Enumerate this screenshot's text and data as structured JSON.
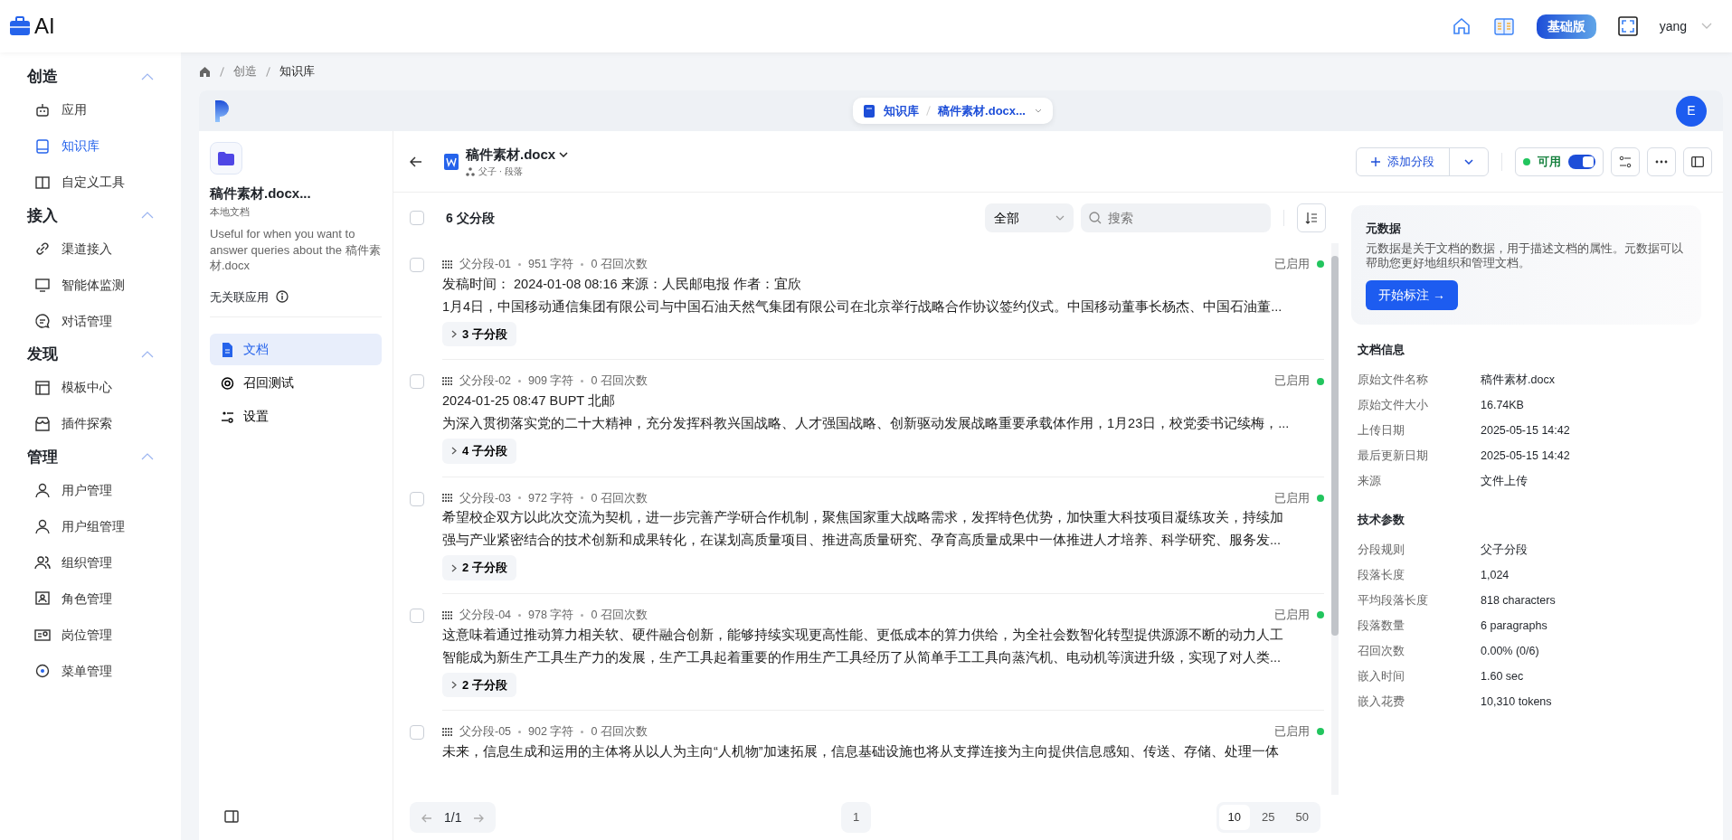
{
  "app": {
    "logo": "AI"
  },
  "header": {
    "edition": "基础版",
    "user": "yang"
  },
  "sidebar": {
    "groups": [
      {
        "title": "创造",
        "expanded": true,
        "items": [
          {
            "label": "应用",
            "selected": false
          },
          {
            "label": "知识库",
            "selected": true
          },
          {
            "label": "自定义工具",
            "selected": false
          }
        ]
      },
      {
        "title": "接入",
        "expanded": true,
        "items": [
          {
            "label": "渠道接入",
            "selected": false
          },
          {
            "label": "智能体监测",
            "selected": false
          },
          {
            "label": "对话管理",
            "selected": false
          }
        ]
      },
      {
        "title": "发现",
        "expanded": true,
        "items": [
          {
            "label": "模板中心",
            "selected": false
          },
          {
            "label": "插件探索",
            "selected": false
          }
        ]
      },
      {
        "title": "管理",
        "expanded": true,
        "items": [
          {
            "label": "用户管理",
            "selected": false
          },
          {
            "label": "用户组管理",
            "selected": false
          },
          {
            "label": "组织管理",
            "selected": false
          },
          {
            "label": "角色管理",
            "selected": false
          },
          {
            "label": "岗位管理",
            "selected": false
          },
          {
            "label": "菜单管理",
            "selected": false
          }
        ]
      }
    ]
  },
  "breadcrumb": [
    "创造",
    "知识库"
  ],
  "topbar": {
    "pill_base": "知识库",
    "pill_doc": "稿件素材.docx...",
    "avatar": "E"
  },
  "doc_panel": {
    "name": "稿件素材.docx...",
    "source": "本地文档",
    "description": "Useful for when you want to answer queries about the 稿件素材.docx",
    "linked_apps": "无关联应用",
    "nav": [
      {
        "label": "文档",
        "selected": true
      },
      {
        "label": "召回测试",
        "selected": false
      },
      {
        "label": "设置",
        "selected": false
      }
    ]
  },
  "document": {
    "title": "稿件素材.docx",
    "subtitle": "父子 · 段落",
    "add_button": "添加分段",
    "status": {
      "label": "可用",
      "on": true
    }
  },
  "segments_header": {
    "count": "6 父分段",
    "checked": false,
    "filter": "全部",
    "search_placeholder": "搜索"
  },
  "segments": [
    {
      "id": "父分段-01",
      "chars": "951 字符",
      "recalls": "0 召回次数",
      "status": "已启用",
      "enabled": true,
      "checked": false,
      "lines": [
        "发稿时间：  2024-01-08 08:16 来源：人民邮电报 作者：宜欣",
        "1月4日，中国移动通信集团有限公司与中国石油天然气集团有限公司在北京举行战略合作协议签约仪式。中国移动董事长杨杰、中国石油董..."
      ],
      "children": "3 子分段"
    },
    {
      "id": "父分段-02",
      "chars": "909 字符",
      "recalls": "0 召回次数",
      "status": "已启用",
      "enabled": true,
      "checked": false,
      "lines": [
        "2024-01-25 08:47 BUPT 北邮",
        "为深入贯彻落实党的二十大精神，充分发挥科教兴国战略、人才强国战略、创新驱动发展战略重要承载体作用，1月23日，校党委书记续梅，..."
      ],
      "children": "4 子分段"
    },
    {
      "id": "父分段-03",
      "chars": "972 字符",
      "recalls": "0 召回次数",
      "status": "已启用",
      "enabled": true,
      "checked": false,
      "lines": [
        "希望校企双方以此次交流为契机，进一步完善产学研合作机制，聚焦国家重大战略需求，发挥特色优势，加快重大科技项目凝练攻关，持续加",
        "强与产业紧密结合的技术创新和成果转化，在谋划高质量项目、推进高质量研究、孕育高质量成果中一体推进人才培养、科学研究、服务发..."
      ],
      "children": "2 子分段"
    },
    {
      "id": "父分段-04",
      "chars": "978 字符",
      "recalls": "0 召回次数",
      "status": "已启用",
      "enabled": true,
      "checked": false,
      "lines": [
        "这意味着通过推动算力相关软、硬件融合创新，能够持续实现更高性能、更低成本的算力供给，为全社会数智化转型提供源源不断的动力人工",
        "智能成为新生产工具生产力的发展，生产工具起着重要的作用生产工具经历了从简单手工工具向蒸汽机、电动机等演进升级，实现了对人类..."
      ],
      "children": "2 子分段"
    },
    {
      "id": "父分段-05",
      "chars": "902 字符",
      "recalls": "0 召回次数",
      "status": "已启用",
      "enabled": true,
      "checked": false,
      "lines": [
        "未来，信息生成和运用的主体将从以人为主向“人机物”加速拓展，信息基础设施也将从支撑连接为主向提供信息感知、传送、存储、处理一体"
      ]
    }
  ],
  "pagination": {
    "page": "1/1",
    "current": "1",
    "sizes": [
      {
        "label": "10",
        "selected": true
      },
      {
        "label": "25",
        "selected": false
      },
      {
        "label": "50",
        "selected": false
      }
    ]
  },
  "metadata": {
    "title": "元数据",
    "description": "元数据是关于文档的数据，用于描述文档的属性。元数据可以帮助您更好地组织和管理文档。",
    "button": "开始标注 →"
  },
  "doc_info": {
    "title": "文档信息",
    "rows": [
      {
        "label": "原始文件名称",
        "value": "稿件素材.docx"
      },
      {
        "label": "原始文件大小",
        "value": "16.74KB"
      },
      {
        "label": "上传日期",
        "value": "2025-05-15 14:42"
      },
      {
        "label": "最后更新日期",
        "value": "2025-05-15 14:42"
      },
      {
        "label": "来源",
        "value": "文件上传"
      }
    ]
  },
  "tech_params": {
    "title": "技术参数",
    "rows": [
      {
        "label": "分段规则",
        "value": "父子分段"
      },
      {
        "label": "段落长度",
        "value": "1,024"
      },
      {
        "label": "平均段落长度",
        "value": "818 characters"
      },
      {
        "label": "段落数量",
        "value": "6 paragraphs"
      },
      {
        "label": "召回次数",
        "value": "0.00% (0/6)"
      },
      {
        "label": "嵌入时间",
        "value": "1.60 sec"
      },
      {
        "label": "嵌入花费",
        "value": "10,310 tokens"
      }
    ]
  }
}
